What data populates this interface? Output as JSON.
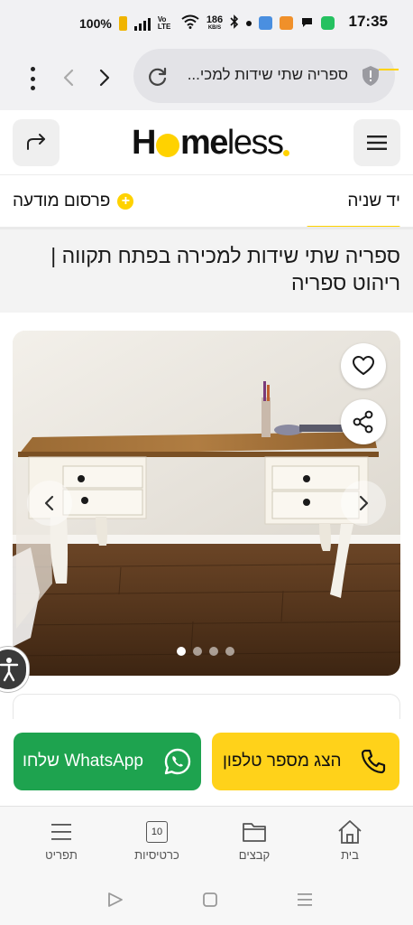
{
  "status_bar": {
    "time": "17:35",
    "battery_percent": "100%",
    "network_label": "Vo LTE",
    "speed_value": "186",
    "speed_unit": "KB/S"
  },
  "browser": {
    "url_text": "ספריה שתי שידות למכי...",
    "icons": [
      "more-vert-icon",
      "back-arrow-icon",
      "forward-arrow-icon",
      "reload-icon",
      "shield-icon"
    ]
  },
  "site_header": {
    "logo_prefix": "H",
    "logo_middle": "me",
    "logo_suffix": "less",
    "brand_color": "#ffd200"
  },
  "category_bar": {
    "category_label": "יד שניה",
    "post_ad_label": "פרסום מודעה",
    "plus_symbol": "+"
  },
  "listing": {
    "title": "ספריה שתי שידות למכירה בפתח תקווה | ריהוט ספריה"
  },
  "gallery": {
    "image_count": 4,
    "active_index": 0
  },
  "actions": {
    "phone_label": "הצג מספר טלפון",
    "whatsapp_label": "שלחו WhatsApp",
    "phone_color": "#ffd21a",
    "whatsapp_color": "#1ea34f"
  },
  "bottom_nav": {
    "items": [
      {
        "label": "בית",
        "icon": "home-icon"
      },
      {
        "label": "קבצים",
        "icon": "folder-icon"
      },
      {
        "label": "כרטיסיות",
        "icon": "tabs-count-icon",
        "count": "10"
      },
      {
        "label": "תפריט",
        "icon": "menu-icon"
      }
    ]
  }
}
